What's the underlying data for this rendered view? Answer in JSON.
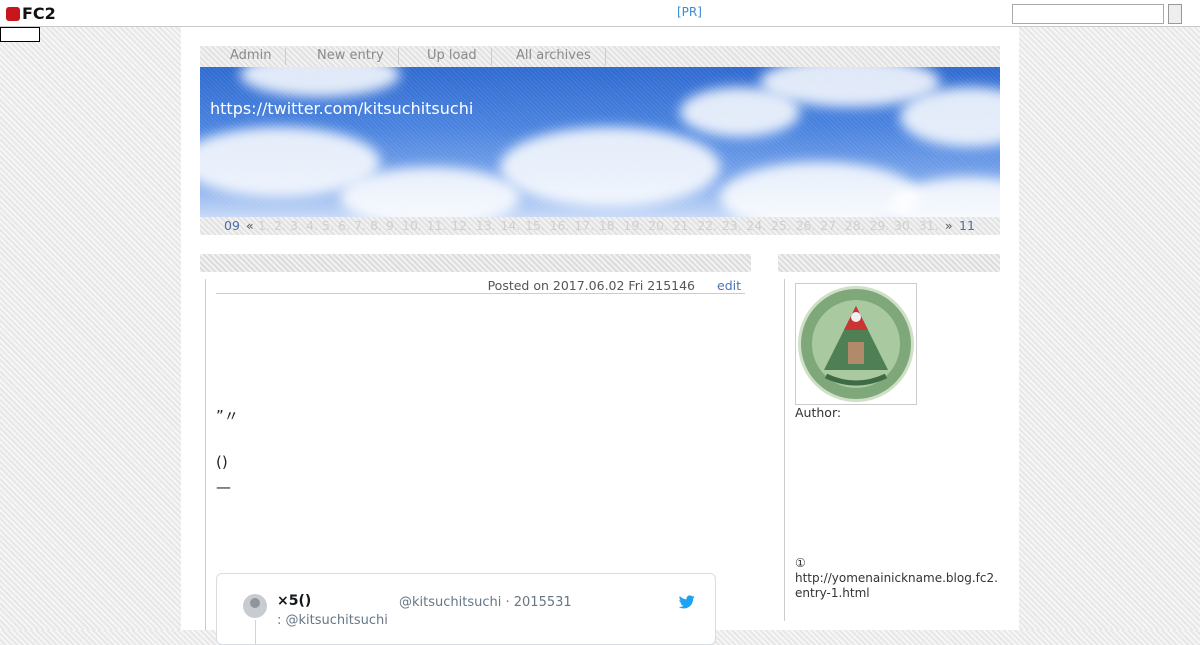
{
  "fc2": {
    "logo": "FC2",
    "pr": "[PR]",
    "search_placeholder": ""
  },
  "nav": [
    {
      "label": "Admin"
    },
    {
      "label": "New entry"
    },
    {
      "label": "Up load"
    },
    {
      "label": "All archives"
    }
  ],
  "header": {
    "title": "https://twitter.com/kitsuchitsuchi"
  },
  "calendar": {
    "prev_month": "09",
    "prev_arrow": "«",
    "days": [
      "1",
      "2",
      "3",
      "4",
      "5",
      "6",
      "7",
      "8",
      "9",
      "10",
      "11",
      "12",
      "13",
      "14",
      "15",
      "16",
      "17",
      "18",
      "19",
      "20",
      "21",
      "22",
      "23",
      "24",
      "25",
      "26",
      "27",
      "28",
      "29",
      "30",
      "31"
    ],
    "next_arrow": "»",
    "next_month": "11"
  },
  "entry": {
    "posted": "Posted on 2017.06.02 Fri 215146",
    "edit": "edit",
    "quote_marks": "”〃",
    "paren": "()",
    "dash": "—"
  },
  "tweet": {
    "name": "×5()",
    "handle": "@kitsuchitsuchi · 2015531",
    "reply": ": @kitsuchitsuchi"
  },
  "sidebar": {
    "author_label": "Author:",
    "link_number": "①",
    "link_url": "http://yomenainickname.blog.fc2.entry-1.html"
  }
}
